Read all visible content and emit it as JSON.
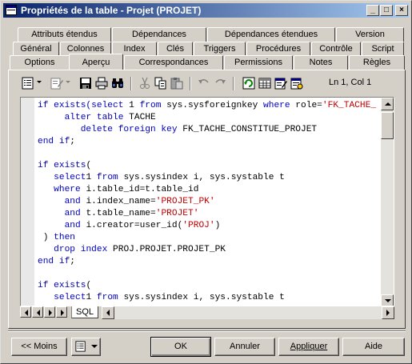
{
  "window": {
    "title": "Propriétés de la table - Projet (PROJET)"
  },
  "tabs": {
    "row1": [
      "Attributs étendus",
      "Dépendances",
      "Dépendances étendues",
      "Version"
    ],
    "row2": [
      "Général",
      "Colonnes",
      "Index",
      "Clés",
      "Triggers",
      "Procédures",
      "Contrôle",
      "Script"
    ],
    "row3": [
      "Options",
      "Aperçu",
      "Correspondances",
      "Permissions",
      "Notes",
      "Règles"
    ],
    "active": "Aperçu"
  },
  "toolbar": {
    "cursor_position": "Ln 1, Col 1"
  },
  "editor": {
    "sheet_tab": "SQL",
    "lines": [
      [
        [
          "kw",
          "if exists("
        ],
        [
          "kw",
          "select"
        ],
        [
          "",
          " 1 "
        ],
        [
          "kw",
          "from"
        ],
        [
          "",
          " sys.sysforeignkey "
        ],
        [
          "kw",
          "where"
        ],
        [
          "",
          " role="
        ],
        [
          "str",
          "'FK_TACHE_"
        ]
      ],
      [
        [
          "",
          "     "
        ],
        [
          "kw",
          "alter table"
        ],
        [
          "",
          " TACHE"
        ]
      ],
      [
        [
          "",
          "        "
        ],
        [
          "kw",
          "delete foreign key"
        ],
        [
          "",
          " FK_TACHE_CONSTITUE_PROJET"
        ]
      ],
      [
        [
          "kw",
          "end if"
        ],
        [
          "",
          ";"
        ]
      ],
      [
        [
          "",
          ""
        ]
      ],
      [
        [
          "kw",
          "if exists"
        ],
        [
          "",
          "("
        ]
      ],
      [
        [
          "",
          "   "
        ],
        [
          "kw",
          "select"
        ],
        [
          "",
          "1 "
        ],
        [
          "kw",
          "from"
        ],
        [
          "",
          " sys.sysindex i, sys.systable t"
        ]
      ],
      [
        [
          "",
          "   "
        ],
        [
          "kw",
          "where"
        ],
        [
          "",
          " i.table_id=t.table_id"
        ]
      ],
      [
        [
          "",
          "     "
        ],
        [
          "kw",
          "and"
        ],
        [
          "",
          " i.index_name="
        ],
        [
          "str",
          "'PROJET_PK'"
        ]
      ],
      [
        [
          "",
          "     "
        ],
        [
          "kw",
          "and"
        ],
        [
          "",
          " t.table_name="
        ],
        [
          "str",
          "'PROJET'"
        ]
      ],
      [
        [
          "",
          "     "
        ],
        [
          "kw",
          "and"
        ],
        [
          "",
          " i.creator=user_id("
        ],
        [
          "str",
          "'PROJ'"
        ],
        [
          "",
          ")"
        ]
      ],
      [
        [
          "",
          " ) "
        ],
        [
          "kw",
          "then"
        ]
      ],
      [
        [
          "",
          "   "
        ],
        [
          "kw",
          "drop index"
        ],
        [
          "",
          " PROJ.PROJET.PROJET_PK"
        ]
      ],
      [
        [
          "kw",
          "end if"
        ],
        [
          "",
          ";"
        ]
      ],
      [
        [
          "",
          ""
        ]
      ],
      [
        [
          "kw",
          "if exists"
        ],
        [
          "",
          "("
        ]
      ],
      [
        [
          "",
          "   "
        ],
        [
          "kw",
          "select"
        ],
        [
          "",
          "1 "
        ],
        [
          "kw",
          "from"
        ],
        [
          "",
          " sys.sysindex i, sys.systable t"
        ]
      ]
    ]
  },
  "buttons": {
    "less": "<< Moins",
    "ok": "OK",
    "cancel": "Annuler",
    "apply": "Appliquer",
    "help": "Aide"
  },
  "colors": {
    "keyword": "#0000c0",
    "string": "#c00000",
    "title_start": "#0a246a",
    "title_end": "#a6caf0"
  }
}
